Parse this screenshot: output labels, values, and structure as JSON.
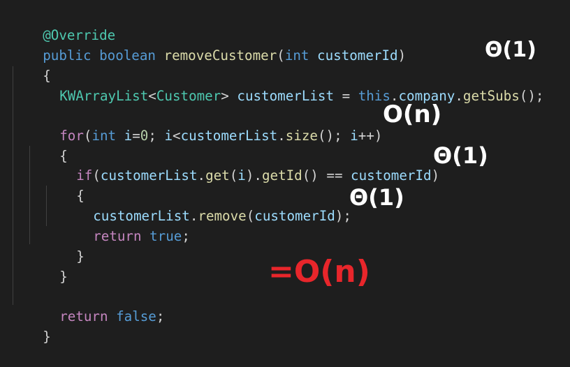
{
  "code": {
    "l1": [
      "@Override"
    ],
    "l2": [
      "public",
      "boolean",
      "removeCustomer",
      "(",
      "int",
      "customerId",
      ")"
    ],
    "l3": [
      "{"
    ],
    "l4": [
      "KWArrayList",
      "<",
      "Customer",
      ">",
      "customerList",
      " = ",
      "this",
      ".",
      "company",
      ".",
      "getSubs",
      "();"
    ],
    "l5": [
      "for",
      "(",
      "int",
      "i",
      "=",
      "0",
      "; ",
      "i",
      "<",
      "customerList",
      ".",
      "size",
      "(); ",
      "i",
      "++)"
    ],
    "l6": [
      "{"
    ],
    "l7": [
      "if",
      "(",
      "customerList",
      ".",
      "get",
      "(",
      "i",
      ").",
      "getId",
      "() == ",
      "customerId",
      ")"
    ],
    "l8": [
      "{"
    ],
    "l9": [
      "customerList",
      ".",
      "remove",
      "(",
      "customerId",
      ");"
    ],
    "l10": [
      "return",
      "true",
      ";"
    ],
    "l11": [
      "}"
    ],
    "l12": [
      "}"
    ],
    "l13": [
      "return",
      "false",
      ";"
    ],
    "l14": [
      "}"
    ]
  },
  "annotations": {
    "theta_sig": "Θ(1)",
    "loop": "O(n)",
    "theta_if": "Θ(1)",
    "theta_remove": "Θ(1)",
    "total": "=O(n)"
  },
  "colors": {
    "background": "#1e1e1e",
    "keyword": "#569cd6",
    "control": "#c586c0",
    "type": "#4ec9b0",
    "function": "#dcdcaa",
    "variable": "#9cdcfe",
    "number": "#b5cea8",
    "handwriting": "#ffffff",
    "handwriting_total": "#e8262b"
  }
}
